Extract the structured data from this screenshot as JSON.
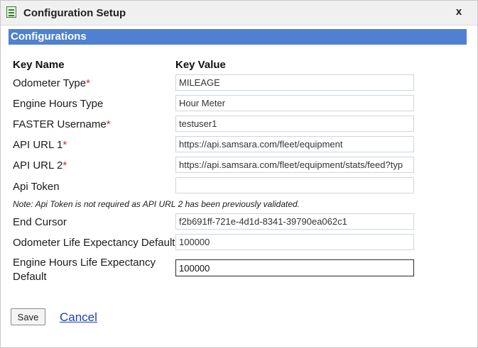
{
  "window": {
    "title": "Configuration Setup",
    "close_glyph": "x"
  },
  "section": {
    "title": "Configurations"
  },
  "columns": {
    "key_name": "Key Name",
    "key_value": "Key Value"
  },
  "fields": [
    {
      "label": "Odometer Type",
      "required": "*",
      "value": "MILEAGE"
    },
    {
      "label": "Engine Hours Type",
      "required": "",
      "value": "Hour Meter"
    },
    {
      "label": "FASTER Username",
      "required": "*",
      "value": "testuser1"
    },
    {
      "label": "API URL 1",
      "required": "*",
      "value": "https://api.samsara.com/fleet/equipment"
    },
    {
      "label": "API URL 2",
      "required": "*",
      "value": "https://api.samsara.com/fleet/equipment/stats/feed?typ"
    },
    {
      "label": "Api Token",
      "required": "",
      "value": ""
    },
    {
      "label": "End Cursor",
      "required": "",
      "value": "f2b691ff-721e-4d1d-8341-39790ea062c1"
    },
    {
      "label": "Odometer Life Expectancy Default",
      "required": "",
      "value": "100000"
    },
    {
      "label_line1": "Engine Hours Life Expectancy",
      "label_line2": "Default",
      "required": "",
      "value": "100000"
    }
  ],
  "note": "Note: Api Token is not required as API URL 2 has been previously validated.",
  "actions": {
    "save": "Save",
    "cancel": "Cancel"
  },
  "icons": {
    "app": "form-icon",
    "close": "close-icon"
  },
  "colors": {
    "section_bar": "#4f81d0",
    "required_marker": "#d9252a",
    "link": "#1a3fb8"
  }
}
